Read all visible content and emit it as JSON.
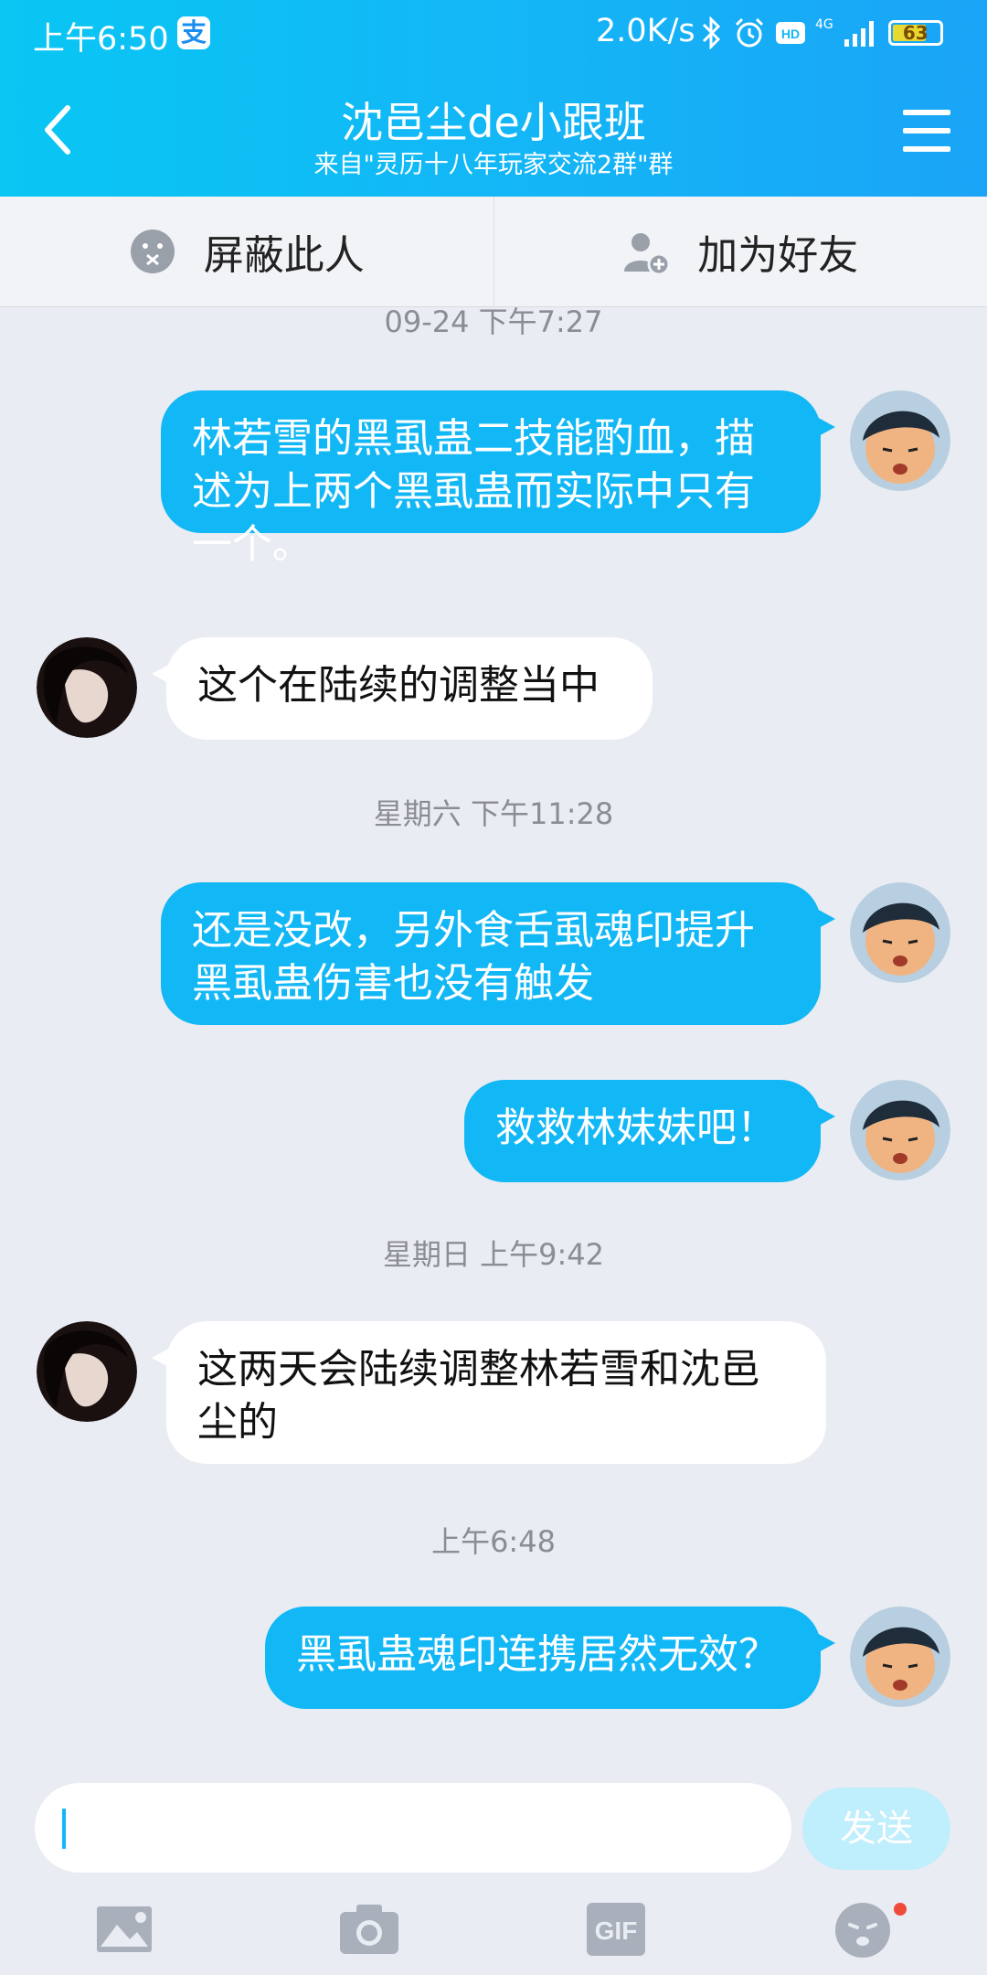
{
  "status_bar": {
    "time": "上午6:50",
    "alipay_badge": "支",
    "speed": "2.0K/s",
    "network": "4G",
    "battery": "63"
  },
  "nav": {
    "title": "沈邑尘de小跟班",
    "subtitle": "来自\"灵历十八年玩家交流2群\"群"
  },
  "actions": {
    "block_label": "屏蔽此人",
    "add_friend_label": "加为好友"
  },
  "messages": [
    {
      "type": "timestamp",
      "text": "09-24  下午7:27"
    },
    {
      "type": "me",
      "text": "林若雪的黑虱蛊二技能酌血，描述为上两个黑虱蛊而实际中只有一个。"
    },
    {
      "type": "them",
      "text": "这个在陆续的调整当中"
    },
    {
      "type": "timestamp",
      "text": "星期六  下午11:28"
    },
    {
      "type": "me",
      "text": "还是没改，另外食舌虱魂印提升黑虱蛊伤害也没有触发"
    },
    {
      "type": "me",
      "text": "救救林妹妹吧！"
    },
    {
      "type": "timestamp",
      "text": "星期日  上午9:42"
    },
    {
      "type": "them",
      "text": "这两天会陆续调整林若雪和沈邑尘的"
    },
    {
      "type": "timestamp",
      "text": "上午6:48"
    },
    {
      "type": "me",
      "text": "黑虱蛊魂印连携居然无效？"
    }
  ],
  "input": {
    "send_label": "发送",
    "gif_label": "GIF"
  },
  "colors": {
    "accent": "#12b7f5",
    "background": "#e9ecf2"
  }
}
